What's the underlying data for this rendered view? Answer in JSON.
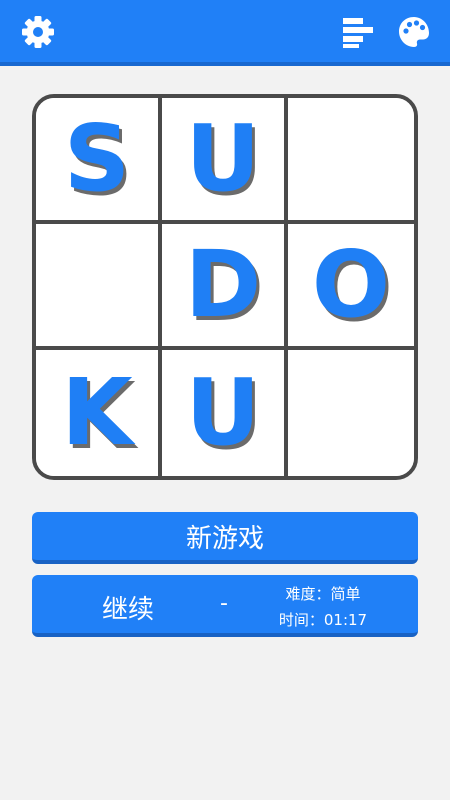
{
  "topbar": {
    "icons": [
      "gear-icon",
      "leaderboard-icon",
      "palette-icon"
    ],
    "color": "#2080f7"
  },
  "board": {
    "cells": [
      "S",
      "U",
      "",
      "",
      "D",
      "O",
      "K",
      "U",
      ""
    ],
    "letter_color": "#1f7ff5"
  },
  "buttons": {
    "new_game": "新游戏",
    "continue_label": "继续",
    "continue_dash": "-",
    "difficulty": "难度：简单",
    "time": "时间：01:17"
  }
}
